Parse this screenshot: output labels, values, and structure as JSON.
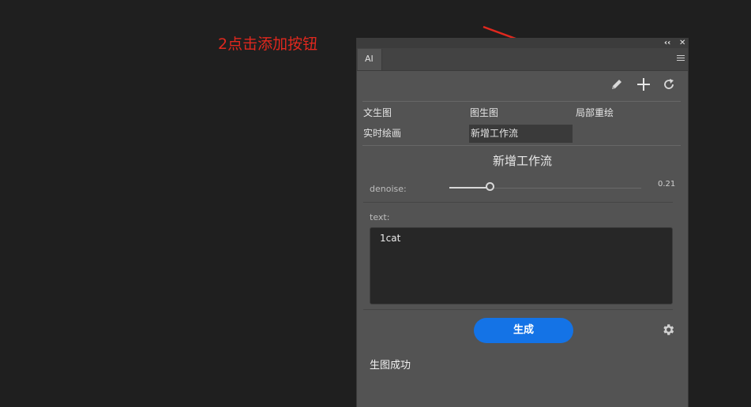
{
  "annotation": {
    "text": "2点击添加按钮"
  },
  "panel": {
    "titlebar": {
      "collapse": "‹‹",
      "close": "✕"
    },
    "tab": {
      "label": "AI"
    },
    "toolbar": {
      "edit_icon": "pencil-icon",
      "add_icon": "plus-icon",
      "refresh_icon": "refresh-icon"
    },
    "modes": [
      "文生图",
      "图生图",
      "局部重绘",
      "实时绘画",
      "新增工作流"
    ],
    "active_mode": "新增工作流",
    "workflow_title": "新增工作流",
    "denoise": {
      "label": "denoise:",
      "value": "0.21",
      "fraction": 0.21
    },
    "text": {
      "label": "text:",
      "value": "1cat"
    },
    "generate_label": "生成",
    "settings_icon": "gear-icon",
    "status": "生图成功"
  },
  "colors": {
    "accent": "#1473e6",
    "annotation": "#e0281e",
    "panel": "#535353",
    "background": "#1f1f1f"
  }
}
